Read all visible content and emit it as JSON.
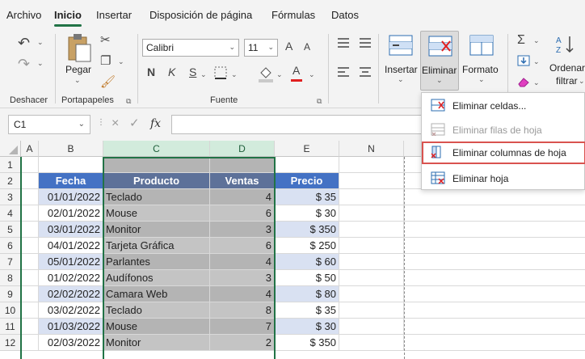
{
  "tabs": [
    "Archivo",
    "Inicio",
    "Insertar",
    "Disposición de página",
    "Fórmulas",
    "Datos"
  ],
  "active_tab": "Inicio",
  "ribbon": {
    "groups": {
      "deshacer": "Deshacer",
      "portapapeles": "Portapapeles",
      "fuente": "Fuente"
    },
    "paste_label": "Pegar",
    "font_name": "Calibri",
    "font_size": "11",
    "bold": "N",
    "italic": "K",
    "underline": "S",
    "insert_label": "Insertar",
    "delete_label": "Eliminar",
    "format_label": "Formato",
    "sort_label_1": "Ordenar",
    "sort_label_2": "filtrar",
    "font_color_letter": "A",
    "grow_font": "A",
    "shrink_font": "A"
  },
  "formula_bar": {
    "name_box": "C1",
    "fx": "fx",
    "cancel": "×",
    "enter": "✓"
  },
  "grid": {
    "columns": [
      "A",
      "B",
      "C",
      "D",
      "E",
      "N"
    ],
    "rows": [
      "1",
      "2",
      "3",
      "4",
      "5",
      "6",
      "7",
      "8",
      "9",
      "10",
      "11",
      "12"
    ],
    "headers": [
      "Fecha",
      "Producto",
      "Ventas",
      "Precio"
    ],
    "data": [
      [
        "01/01/2022",
        "Teclado",
        "4",
        "$ 35"
      ],
      [
        "02/01/2022",
        "Mouse",
        "6",
        "$ 30"
      ],
      [
        "03/01/2022",
        "Monitor",
        "3",
        "$ 350"
      ],
      [
        "04/01/2022",
        "Tarjeta Gráfica",
        "6",
        "$ 250"
      ],
      [
        "05/01/2022",
        "Parlantes",
        "4",
        "$ 60"
      ],
      [
        "01/02/2022",
        "Audífonos",
        "3",
        "$ 50"
      ],
      [
        "02/02/2022",
        "Camara Web",
        "4",
        "$ 80"
      ],
      [
        "03/02/2022",
        "Teclado",
        "8",
        "$ 35"
      ],
      [
        "01/03/2022",
        "Mouse",
        "7",
        "$ 30"
      ],
      [
        "02/03/2022",
        "Monitor",
        "2",
        "$ 350"
      ]
    ]
  },
  "dropdown": {
    "items": [
      {
        "label": "Eliminar celdas...",
        "disabled": false
      },
      {
        "label": "Eliminar filas de hoja",
        "disabled": true
      },
      {
        "label": "Eliminar columnas de hoja",
        "disabled": false
      },
      {
        "label": "Eliminar hoja",
        "disabled": false
      }
    ]
  },
  "colors": {
    "accent": "#217346",
    "header_blue": "#4472c4",
    "band_blue": "#d9e1f2",
    "highlight": "#d9534f"
  }
}
